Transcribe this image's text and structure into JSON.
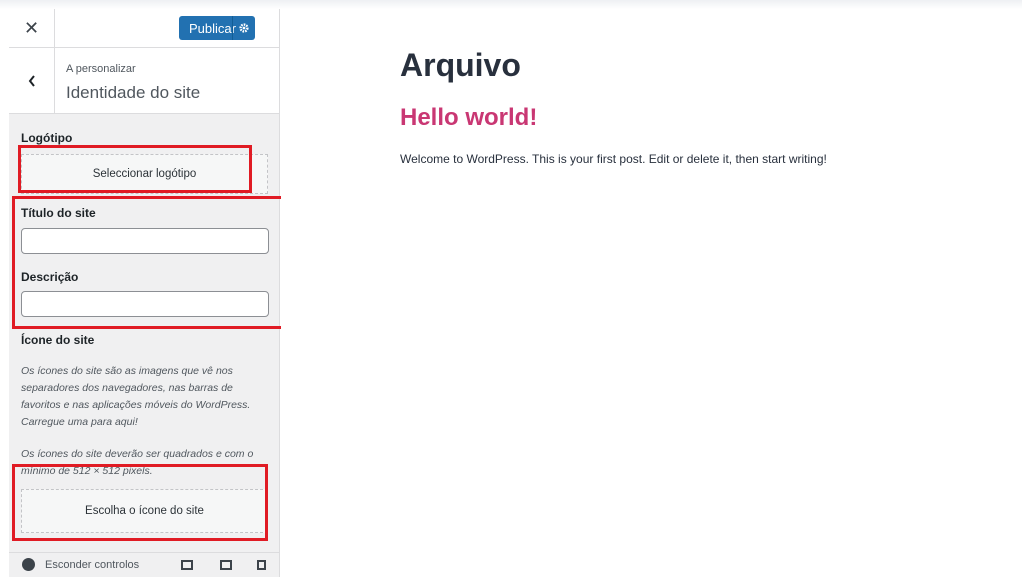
{
  "header": {
    "close_icon_glyph": "✕",
    "publish_label": "Publicar"
  },
  "section": {
    "breadcrumb": "A personalizar",
    "title": "Identidade do site"
  },
  "logo": {
    "label": "Logótipo",
    "button": "Seleccionar logótipo"
  },
  "site_title": {
    "label": "Título do site",
    "value": ""
  },
  "description": {
    "label": "Descrição",
    "value": ""
  },
  "site_icon": {
    "label": "Ícone do site",
    "desc1": "Os ícones do site são as imagens que vê nos separadores dos navegadores, nas barras de favoritos e nas aplicações móveis do WordPress. Carregue uma para aqui!",
    "desc2": "Os ícones do site deverão ser quadrados e com o mínimo de 512 × 512 pixels.",
    "button": "Escolha o ícone do site"
  },
  "footer": {
    "hide_controls": "Esconder controlos"
  },
  "preview": {
    "archive_title": "Arquivo",
    "post_title": "Hello world!",
    "post_excerpt": "Welcome to WordPress. This is your first post. Edit or delete it, then start writing!"
  },
  "colors": {
    "primary": "#2271b1",
    "post_title": "#c93773",
    "highlight": "#e01b24"
  }
}
